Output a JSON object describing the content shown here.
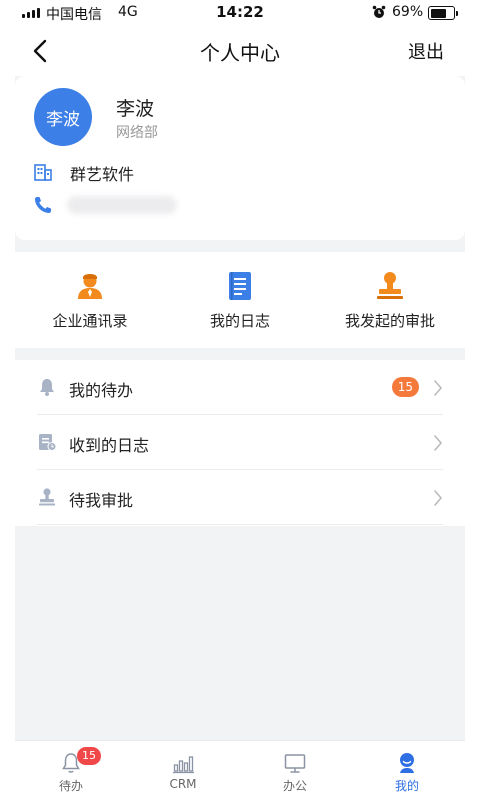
{
  "status": {
    "carrier": "中国电信",
    "network": "4G",
    "time": "14:22",
    "battery": "69%",
    "battery_level": 0.69
  },
  "nav": {
    "title": "个人中心",
    "logout": "退出"
  },
  "profile": {
    "avatar_text": "李波",
    "name": "李波",
    "department": "网络部",
    "company": "群艺软件"
  },
  "shortcuts": [
    {
      "label": "企业通讯录",
      "icon": "contacts-icon",
      "color": "#f28a1d"
    },
    {
      "label": "我的日志",
      "icon": "journal-icon",
      "color": "#3c7fe6"
    },
    {
      "label": "我发起的审批",
      "icon": "stamp-icon",
      "color": "#f28a1d"
    }
  ],
  "list": {
    "items": [
      {
        "label": "我的待办",
        "icon": "bell-icon",
        "badge": "15"
      },
      {
        "label": "收到的日志",
        "icon": "log-received-icon"
      },
      {
        "label": "待我审批",
        "icon": "approval-stamp-icon"
      }
    ]
  },
  "tabbar": {
    "tabs": [
      {
        "label": "待办",
        "icon": "bell-icon",
        "badge": "15"
      },
      {
        "label": "CRM",
        "icon": "bar-chart-icon"
      },
      {
        "label": "办公",
        "icon": "monitor-icon"
      },
      {
        "label": "我的",
        "icon": "user-icon",
        "active": true
      }
    ]
  },
  "colors": {
    "accent": "#3c7fe6",
    "orange": "#f28a1d",
    "badge_orange": "#f5793b",
    "badge_red": "#f04848"
  }
}
